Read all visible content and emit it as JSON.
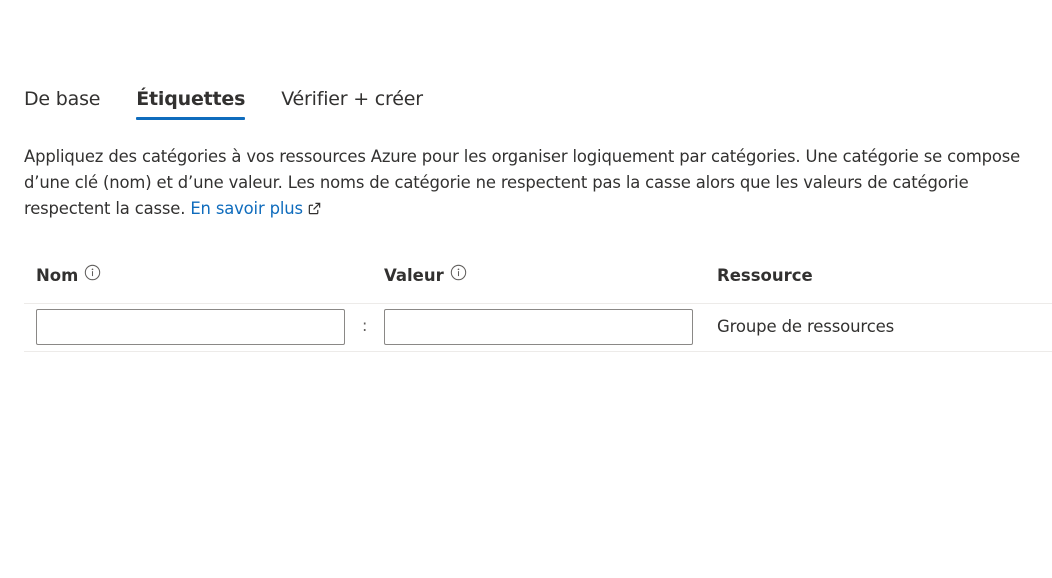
{
  "tabs": [
    {
      "label": "De base",
      "active": false
    },
    {
      "label": "Étiquettes",
      "active": true
    },
    {
      "label": "Vérifier + créer",
      "active": false
    }
  ],
  "description": {
    "text": "Appliquez des catégories à vos ressources Azure pour les organiser logiquement par catégories. Une catégorie se compose d’une clé (nom) et d’une valeur. Les noms de catégorie ne respectent pas la casse alors que les valeurs de catégorie respectent la casse. ",
    "link_text": "En savoir plus",
    "link_icon": "external-link-icon"
  },
  "table": {
    "columns": {
      "name": {
        "label": "Nom",
        "icon": "info-icon"
      },
      "value": {
        "label": "Valeur",
        "icon": "info-icon"
      },
      "resource": {
        "label": "Ressource"
      }
    },
    "rows": [
      {
        "name_value": "",
        "separator": ":",
        "value_value": "",
        "resource": "Groupe de ressources"
      }
    ]
  },
  "colors": {
    "accent": "#0f6cbd",
    "text": "#323130",
    "border": "#8a8886",
    "divider": "#edebe9"
  }
}
